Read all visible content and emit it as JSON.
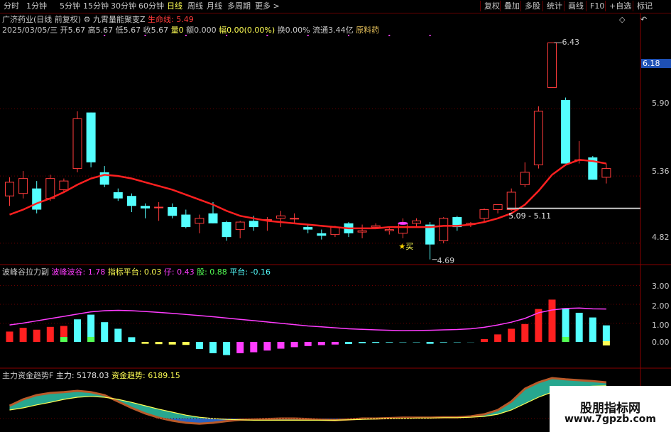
{
  "toolbar": {
    "periods": [
      "分时",
      "1分钟",
      "5分钟",
      "15分钟",
      "30分钟",
      "60分钟",
      "日线",
      "周线",
      "月线",
      "多周期",
      "更多 >"
    ],
    "active_period": "日线",
    "right_buttons": [
      "复权",
      "叠加",
      "多股",
      "统计",
      "画线",
      "F10",
      "+自选",
      "标记"
    ],
    "diamond_icon": "diamond-icon",
    "back_icon": "back-arrow-icon"
  },
  "header": {
    "stock_title": "广济药业(日线 前复权)",
    "indicator_icon": "gear-circle-icon",
    "indicator_name": "九霄量能聚变Z",
    "lifeline_label": "生命线: 5.49",
    "row2": [
      {
        "text": "2025/03/05/三",
        "color": "#c8c8c8"
      },
      {
        "text": "开5.67",
        "color": "#c8c8c8"
      },
      {
        "text": "高5.67",
        "color": "#c8c8c8"
      },
      {
        "text": "低5.67",
        "color": "#c8c8c8"
      },
      {
        "text": "收5.67",
        "color": "#c8c8c8"
      },
      {
        "text": "量0",
        "color": "#ffff54"
      },
      {
        "text": "额0.000",
        "color": "#c8c8c8"
      },
      {
        "text": "幅0.00(0.00%)",
        "color": "#ffff54"
      },
      {
        "text": "换0.00%",
        "color": "#c8c8c8"
      },
      {
        "text": "流通3.44亿",
        "color": "#c8c8c8"
      },
      {
        "text": "原料药",
        "color": "#e6c15a"
      }
    ]
  },
  "price_axis": {
    "ticks": [
      "5.90",
      "5.36",
      "4.82"
    ],
    "current_price": "6.18"
  },
  "annotations": {
    "high": "6.43",
    "low": "4.69",
    "range": "5.09 - 5.11",
    "buy_label": "买"
  },
  "sub1": {
    "name": "波峰谷拉力副",
    "values": [
      {
        "label": "波峰波谷: 1.78",
        "color": "#ff3cff"
      },
      {
        "label": "指标平台: 0.03",
        "color": "#ffff54"
      },
      {
        "label": "仔: 0.43",
        "color": "#ff3cff"
      },
      {
        "label": "股: 0.88",
        "color": "#54ff54"
      },
      {
        "label": "平台: -0.16",
        "color": "#54ffff"
      }
    ],
    "axis": [
      "3.00",
      "2.00",
      "1.00",
      "0.00"
    ]
  },
  "sub2": {
    "name": "主力资金趋势F",
    "values": [
      {
        "label": "主力: 5178.03",
        "color": "#e8e8e8"
      },
      {
        "label": "资金趋势: 6189.15",
        "color": "#ffff54"
      }
    ]
  },
  "watermark": {
    "line1": "股朋指标网",
    "line2": "www.7gpzb.com"
  },
  "chart_data": {
    "type": "candlestick",
    "y_range": [
      4.66,
      6.5
    ],
    "candles": [
      {
        "o": 5.2,
        "h": 5.35,
        "l": 5.12,
        "c": 5.31
      },
      {
        "o": 5.22,
        "h": 5.4,
        "l": 5.18,
        "c": 5.34
      },
      {
        "o": 5.26,
        "h": 5.32,
        "l": 5.06,
        "c": 5.09
      },
      {
        "o": 5.18,
        "h": 5.37,
        "l": 5.16,
        "c": 5.34
      },
      {
        "o": 5.25,
        "h": 5.34,
        "l": 5.23,
        "c": 5.32
      },
      {
        "o": 5.42,
        "h": 5.88,
        "l": 5.39,
        "c": 5.82
      },
      {
        "o": 5.87,
        "h": 5.87,
        "l": 5.43,
        "c": 5.47
      },
      {
        "o": 5.39,
        "h": 5.44,
        "l": 5.27,
        "c": 5.29
      },
      {
        "o": 5.23,
        "h": 5.26,
        "l": 5.16,
        "c": 5.18
      },
      {
        "o": 5.2,
        "h": 5.22,
        "l": 5.07,
        "c": 5.12
      },
      {
        "o": 5.12,
        "h": 5.14,
        "l": 5.02,
        "c": 5.1
      },
      {
        "o": 5.11,
        "h": 5.15,
        "l": 5.0,
        "c": 5.11
      },
      {
        "o": 5.11,
        "h": 5.14,
        "l": 5.02,
        "c": 5.04
      },
      {
        "o": 5.05,
        "h": 5.09,
        "l": 4.94,
        "c": 4.95
      },
      {
        "o": 4.98,
        "h": 5.05,
        "l": 4.9,
        "c": 5.02
      },
      {
        "o": 5.06,
        "h": 5.15,
        "l": 4.98,
        "c": 4.98
      },
      {
        "o": 4.99,
        "h": 5.0,
        "l": 4.84,
        "c": 4.87
      },
      {
        "o": 4.93,
        "h": 5.0,
        "l": 4.86,
        "c": 4.99
      },
      {
        "o": 5.0,
        "h": 5.04,
        "l": 4.92,
        "c": 4.95
      },
      {
        "o": 5.01,
        "h": 5.03,
        "l": 4.92,
        "c": 5.01
      },
      {
        "o": 5.02,
        "h": 5.08,
        "l": 4.95,
        "c": 5.04
      },
      {
        "o": 5.02,
        "h": 5.06,
        "l": 4.98,
        "c": 5.02
      },
      {
        "o": 4.95,
        "h": 4.97,
        "l": 4.9,
        "c": 4.93
      },
      {
        "o": 4.9,
        "h": 4.93,
        "l": 4.85,
        "c": 4.88
      },
      {
        "o": 4.89,
        "h": 4.96,
        "l": 4.87,
        "c": 4.95
      },
      {
        "o": 4.98,
        "h": 4.99,
        "l": 4.87,
        "c": 4.9
      },
      {
        "o": 4.91,
        "h": 4.97,
        "l": 4.86,
        "c": 4.92
      },
      {
        "o": 4.95,
        "h": 4.98,
        "l": 4.94,
        "c": 4.96
      },
      {
        "o": 4.92,
        "h": 4.95,
        "l": 4.89,
        "c": 4.93
      },
      {
        "o": 4.9,
        "h": 5.02,
        "l": 4.86,
        "c": 4.98
      },
      {
        "o": 4.98,
        "h": 5.02,
        "l": 4.95,
        "c": 5.0
      },
      {
        "o": 4.97,
        "h": 4.99,
        "l": 4.69,
        "c": 4.81
      },
      {
        "o": 4.84,
        "h": 5.03,
        "l": 4.82,
        "c": 5.02
      },
      {
        "o": 5.03,
        "h": 5.04,
        "l": 4.92,
        "c": 4.95
      },
      {
        "o": 4.97,
        "h": 4.99,
        "l": 4.95,
        "c": 4.98
      },
      {
        "o": 5.02,
        "h": 5.1,
        "l": 4.99,
        "c": 5.09
      },
      {
        "o": 5.09,
        "h": 5.13,
        "l": 5.06,
        "c": 5.13
      },
      {
        "o": 5.09,
        "h": 5.26,
        "l": 5.08,
        "c": 5.23
      },
      {
        "o": 5.29,
        "h": 5.47,
        "l": 5.27,
        "c": 5.39
      },
      {
        "o": 5.45,
        "h": 5.92,
        "l": 5.42,
        "c": 5.88
      },
      {
        "o": 6.07,
        "h": 6.43,
        "l": 6.07,
        "c": 6.43
      },
      {
        "o": 5.97,
        "h": 5.99,
        "l": 5.46,
        "c": 5.46
      },
      {
        "o": 5.49,
        "h": 5.64,
        "l": 5.46,
        "c": 5.49
      },
      {
        "o": 5.51,
        "h": 5.52,
        "l": 5.33,
        "c": 5.33
      },
      {
        "o": 5.35,
        "h": 5.46,
        "l": 5.3,
        "c": 5.42
      }
    ],
    "lifeline": [
      5.05,
      5.09,
      5.14,
      5.18,
      5.23,
      5.29,
      5.34,
      5.37,
      5.36,
      5.34,
      5.31,
      5.28,
      5.25,
      5.21,
      5.17,
      5.13,
      5.08,
      5.04,
      5.02,
      5.0,
      4.99,
      4.98,
      4.97,
      4.96,
      4.95,
      4.94,
      4.94,
      4.94,
      4.95,
      4.95,
      4.95,
      4.95,
      4.96,
      4.96,
      4.97,
      4.99,
      5.02,
      5.06,
      5.13,
      5.24,
      5.37,
      5.45,
      5.49,
      5.48,
      5.46
    ],
    "support_level": 5.1,
    "sub1_bars": [
      0.55,
      0.75,
      0.65,
      0.8,
      0.85,
      1.2,
      1.45,
      1.05,
      0.7,
      0.25,
      -0.1,
      -0.12,
      -0.14,
      -0.16,
      -0.38,
      -0.6,
      -0.7,
      -0.6,
      -0.55,
      -0.46,
      -0.36,
      -0.28,
      -0.22,
      -0.17,
      -0.14,
      -0.11,
      -0.07,
      -0.05,
      -0.03,
      -0.02,
      -0.02,
      -0.1,
      -0.03,
      -0.02,
      -0.01,
      0.15,
      0.4,
      0.7,
      0.95,
      1.75,
      2.25,
      1.8,
      1.55,
      1.3,
      0.88
    ],
    "sub1_line": [
      0.9,
      1.0,
      1.12,
      1.24,
      1.36,
      1.48,
      1.6,
      1.66,
      1.68,
      1.66,
      1.62,
      1.57,
      1.52,
      1.46,
      1.4,
      1.34,
      1.27,
      1.2,
      1.13,
      1.06,
      0.99,
      0.92,
      0.85,
      0.8,
      0.75,
      0.7,
      0.67,
      0.64,
      0.62,
      0.6,
      0.61,
      0.62,
      0.64,
      0.66,
      0.7,
      0.78,
      0.9,
      1.05,
      1.25,
      1.55,
      1.7,
      1.78,
      1.8,
      1.76,
      1.75
    ],
    "sub2_main": [
      0.3,
      0.45,
      0.55,
      0.6,
      0.62,
      0.65,
      0.62,
      0.55,
      0.4,
      0.25,
      0.12,
      0.02,
      -0.05,
      -0.1,
      -0.12,
      -0.1,
      -0.06,
      -0.03,
      -0.02,
      -0.01,
      0.0,
      0.0,
      -0.01,
      -0.03,
      -0.04,
      -0.02,
      0.0,
      0.0,
      0.01,
      0.02,
      0.02,
      0.02,
      0.03,
      0.03,
      0.05,
      0.1,
      0.2,
      0.4,
      0.7,
      0.85,
      0.95,
      0.92,
      0.9,
      0.88,
      0.85
    ],
    "sub2_trend": [
      0.2,
      0.25,
      0.32,
      0.38,
      0.45,
      0.5,
      0.52,
      0.5,
      0.45,
      0.38,
      0.3,
      0.22,
      0.15,
      0.08,
      0.03,
      0.0,
      -0.02,
      -0.03,
      -0.04,
      -0.04,
      -0.04,
      -0.04,
      -0.04,
      -0.04,
      -0.04,
      -0.03,
      -0.02,
      -0.01,
      0.0,
      0.0,
      0.01,
      0.01,
      0.02,
      0.02,
      0.03,
      0.05,
      0.1,
      0.2,
      0.35,
      0.5,
      0.62,
      0.7,
      0.74,
      0.76,
      0.77
    ]
  }
}
